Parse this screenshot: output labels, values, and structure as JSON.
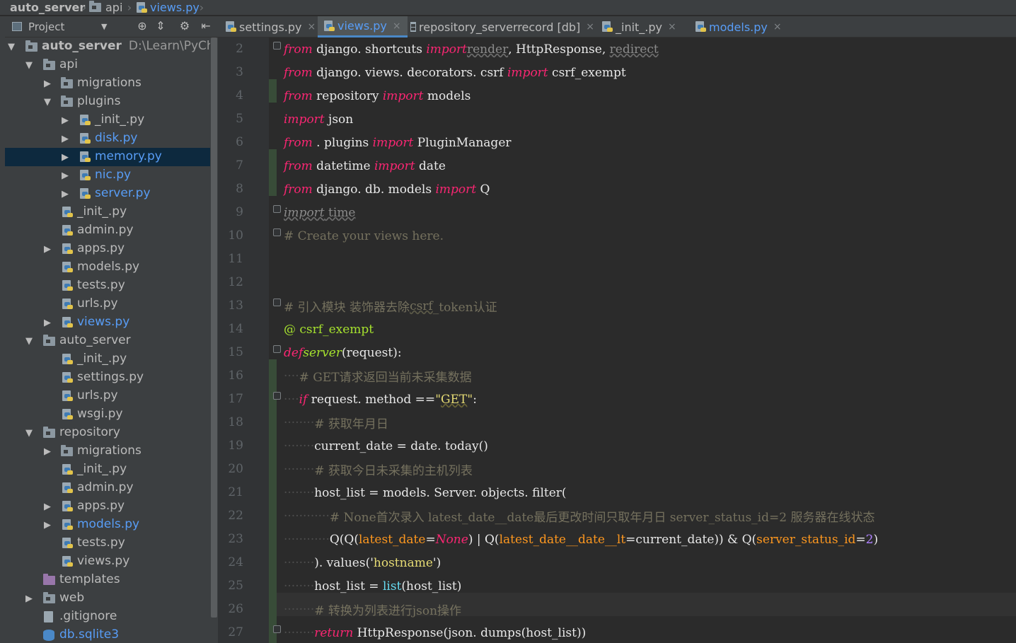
{
  "navbar": {
    "crumbs": [
      {
        "label": "auto_server",
        "icon": "folder-icon"
      },
      {
        "label": "api",
        "icon": "folder-icon"
      },
      {
        "label": "views.py",
        "icon": "python-file-icon"
      }
    ]
  },
  "panel": {
    "title": "Project",
    "icons": [
      "crosshair-icon",
      "collapse-icon",
      "gear-icon",
      "hide-icon"
    ]
  },
  "tabs": [
    {
      "label": "settings.py",
      "icon": "python-file-icon",
      "active": false
    },
    {
      "label": "views.py",
      "icon": "python-file-icon",
      "active": true
    },
    {
      "label": "repository_serverrecord [db]",
      "icon": "db-table-icon",
      "active": false
    },
    {
      "label": "_init_.py",
      "icon": "python-file-icon",
      "active": false
    },
    {
      "label": "models.py",
      "icon": "python-file-icon",
      "active": false
    }
  ],
  "tree": {
    "root_name": "auto_server",
    "root_path": "D:\\Learn\\PyCharm\\",
    "items": [
      {
        "label": "api"
      },
      {
        "label": "migrations"
      },
      {
        "label": "plugins"
      },
      {
        "label": "_init_.py"
      },
      {
        "label": "disk.py"
      },
      {
        "label": "memory.py"
      },
      {
        "label": "nic.py"
      },
      {
        "label": "server.py"
      },
      {
        "label": "_init_.py"
      },
      {
        "label": "admin.py"
      },
      {
        "label": "apps.py"
      },
      {
        "label": "models.py"
      },
      {
        "label": "tests.py"
      },
      {
        "label": "urls.py"
      },
      {
        "label": "views.py"
      },
      {
        "label": "auto_server"
      },
      {
        "label": "_init_.py"
      },
      {
        "label": "settings.py"
      },
      {
        "label": "urls.py"
      },
      {
        "label": "wsgi.py"
      },
      {
        "label": "repository"
      },
      {
        "label": "migrations"
      },
      {
        "label": "_init_.py"
      },
      {
        "label": "admin.py"
      },
      {
        "label": "apps.py"
      },
      {
        "label": "models.py"
      },
      {
        "label": "tests.py"
      },
      {
        "label": "views.py"
      },
      {
        "label": "templates"
      },
      {
        "label": "web"
      },
      {
        "label": ".gitignore"
      },
      {
        "label": "db.sqlite3"
      }
    ]
  },
  "line_numbers": [
    "2",
    "3",
    "4",
    "5",
    "6",
    "7",
    "8",
    "9",
    "10",
    "11",
    "12",
    "13",
    "14",
    "15",
    "16",
    "17",
    "18",
    "19",
    "20",
    "21",
    "22",
    "23",
    "24",
    "25",
    "26",
    "27"
  ],
  "code": {
    "l2": {
      "from": "from",
      "mod": " django. shortcuts ",
      "imp": "import",
      "render": "render",
      "sep1": ", ",
      "resp": "HttpResponse",
      "sep2": ", ",
      "redirect": "redirect"
    },
    "l3": {
      "from": "from",
      "mod": " django. views. decorators. csrf ",
      "imp": "import",
      "name": " csrf_exempt"
    },
    "l4": {
      "from": "from",
      "mod": " repository ",
      "imp": "import",
      "name": " models"
    },
    "l5": {
      "imp": "import",
      "name": " json"
    },
    "l6": {
      "from": "from",
      "mod": " . plugins ",
      "imp": "import",
      "name": " PluginManager"
    },
    "l7": {
      "from": "from",
      "mod": " datetime ",
      "imp": "import",
      "name": " date"
    },
    "l8": {
      "from": "from",
      "mod": " django. db. models ",
      "imp": "import",
      "name": " Q"
    },
    "l9": {
      "imp": "import",
      "name": " time"
    },
    "l10": {
      "comment": "# Create your views here."
    },
    "l13": {
      "c1": "# 引入模块 装饰器去除",
      "csrf": "csrf",
      "c2": "_token认证"
    },
    "l14": {
      "at": "@",
      "name": " csrf_exempt"
    },
    "l15": {
      "def": "def",
      "fname": "server",
      "args": "(request):"
    },
    "l16": {
      "comment": "# GET请求返回当前未采集数据"
    },
    "l17": {
      "if": "if",
      "expr": " request. method ==",
      "q1": "\"",
      "get": "GET",
      "q2": "\"",
      "colon": ":"
    },
    "l18": {
      "comment": "# 获取年月日"
    },
    "l19": {
      "text": "current_date = date. today()"
    },
    "l20": {
      "comment": "# 获取今日未采集的主机列表"
    },
    "l21": {
      "text": "host_list = models. Server. objects. filter("
    },
    "l22": {
      "comment": "# None首次录入 latest_date__date最后更改时间只取年月日 server_status_id=2 服务器在线状态"
    },
    "l23": {
      "t1": "Q(Q(",
      "p1": "latest_date",
      "eq1": "=",
      "none": "None",
      "t2": ") | Q(",
      "p2": "latest_date__date__lt",
      "t3": "=current_date)) & Q(",
      "p3": "server_status_id",
      "eq3": "=",
      "num": "2",
      "t4": ")"
    },
    "l24": {
      "t1": "). values('",
      "s": "hostname",
      "t2": "')"
    },
    "l25": {
      "t1": "host_list = ",
      "bi": "list",
      "t2": "(host_list)"
    },
    "l26": {
      "comment": "# 转换为列表进行json操作"
    },
    "l27": {
      "ret": "return",
      "text": " HttpResponse(json. dumps(host_list))"
    }
  },
  "colors": {
    "keyword": "#f92672",
    "function": "#a6e22e",
    "string": "#e6db74",
    "comment": "#75715e",
    "param": "#fd971f",
    "builtin": "#66d9ef",
    "selection": "#0d293e",
    "link": "#589df6"
  }
}
